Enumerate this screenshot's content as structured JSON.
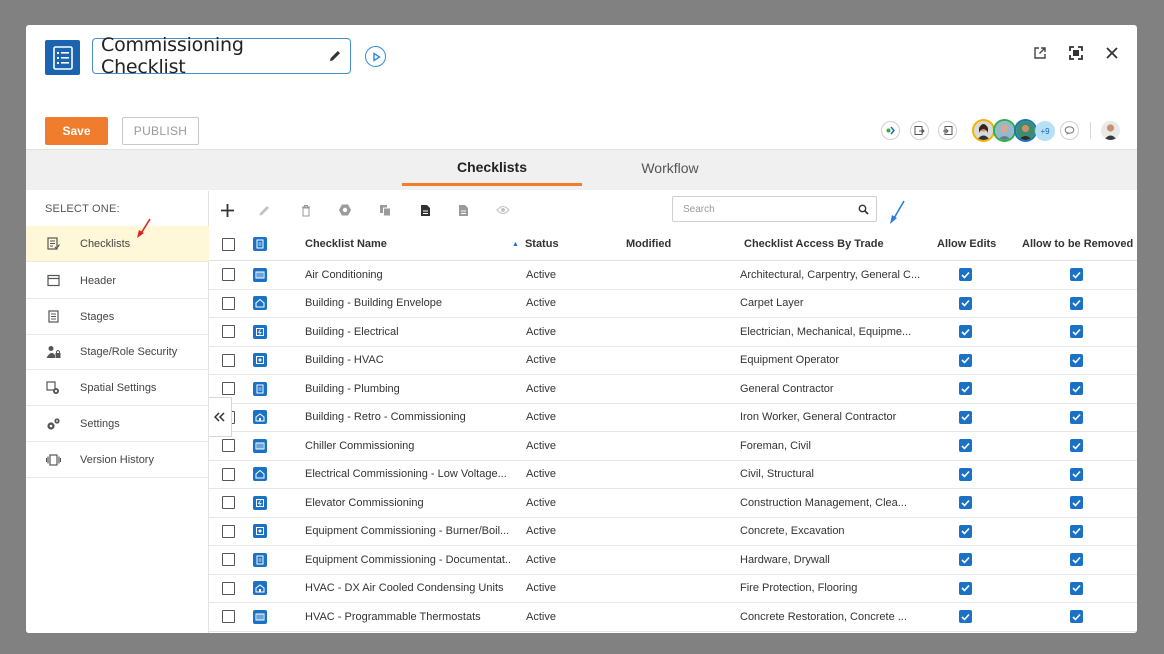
{
  "window": {
    "title": "Commissioning Checklist"
  },
  "toolbar": {
    "save_label": "Save",
    "publish_label": "PUBLISH",
    "more_users_label": "+9"
  },
  "tabs": [
    {
      "label": "Checklists",
      "active": true
    },
    {
      "label": "Workflow",
      "active": false
    }
  ],
  "sidebar": {
    "heading": "SELECT ONE:",
    "items": [
      {
        "label": "Checklists",
        "icon": "checklist-icon",
        "active": true
      },
      {
        "label": "Header",
        "icon": "header-icon",
        "active": false
      },
      {
        "label": "Stages",
        "icon": "stages-icon",
        "active": false
      },
      {
        "label": "Stage/Role Security",
        "icon": "user-lock-icon",
        "active": false
      },
      {
        "label": "Spatial Settings",
        "icon": "spatial-settings-icon",
        "active": false
      },
      {
        "label": "Settings",
        "icon": "gears-icon",
        "active": false
      },
      {
        "label": "Version History",
        "icon": "version-history-icon",
        "active": false
      }
    ]
  },
  "search": {
    "placeholder": "Search"
  },
  "table": {
    "columns": [
      "Checklist Name",
      "Status",
      "Modified",
      "Checklist Access By Trade",
      "Allow Edits",
      "Allow to be Removed"
    ],
    "rows": [
      {
        "name": "Air Conditioning",
        "status": "Active",
        "modified": "",
        "trades": "Architectural, Carpentry, General C...",
        "allow_edits": true,
        "allow_removed": true
      },
      {
        "name": "Building - Building Envelope",
        "status": "Active",
        "modified": "",
        "trades": "Carpet Layer",
        "allow_edits": true,
        "allow_removed": true
      },
      {
        "name": "Building - Electrical",
        "status": "Active",
        "modified": "",
        "trades": "Electrician, Mechanical, Equipme...",
        "allow_edits": true,
        "allow_removed": true
      },
      {
        "name": "Building - HVAC",
        "status": "Active",
        "modified": "",
        "trades": "Equipment Operator",
        "allow_edits": true,
        "allow_removed": true
      },
      {
        "name": "Building - Plumbing",
        "status": "Active",
        "modified": "",
        "trades": "General Contractor",
        "allow_edits": true,
        "allow_removed": true
      },
      {
        "name": "Building - Retro - Commissioning",
        "status": "Active",
        "modified": "",
        "trades": "Iron Worker, General Contractor",
        "allow_edits": true,
        "allow_removed": true
      },
      {
        "name": "Chiller Commissioning",
        "status": "Active",
        "modified": "",
        "trades": "Foreman, Civil",
        "allow_edits": true,
        "allow_removed": true
      },
      {
        "name": "Electrical Commissioning - Low Voltage...",
        "status": "Active",
        "modified": "",
        "trades": "Civil, Structural",
        "allow_edits": true,
        "allow_removed": true
      },
      {
        "name": "Elevator Commissioning",
        "status": "Active",
        "modified": "",
        "trades": "Construction Management, Clea...",
        "allow_edits": true,
        "allow_removed": true
      },
      {
        "name": "Equipment Commissioning - Burner/Boil...",
        "status": "Active",
        "modified": "",
        "trades": "Concrete, Excavation",
        "allow_edits": true,
        "allow_removed": true
      },
      {
        "name": "Equipment Commissioning - Documentat...",
        "status": "Active",
        "modified": "",
        "trades": "Hardware, Drywall",
        "allow_edits": true,
        "allow_removed": true
      },
      {
        "name": "HVAC - DX Air Cooled Condensing Units",
        "status": "Active",
        "modified": "",
        "trades": "Fire Protection, Flooring",
        "allow_edits": true,
        "allow_removed": true
      },
      {
        "name": "HVAC - Programmable Thermostats",
        "status": "Active",
        "modified": "",
        "trades": "Concrete Restoration, Concrete ...",
        "allow_edits": true,
        "allow_removed": true
      }
    ]
  },
  "colors": {
    "accent": "#f07c2e",
    "brand": "#1b64b0",
    "checkbox": "#1b72c4",
    "overlay": "#818181",
    "annotation_red": "#e02020",
    "annotation_blue": "#2b7be0"
  }
}
